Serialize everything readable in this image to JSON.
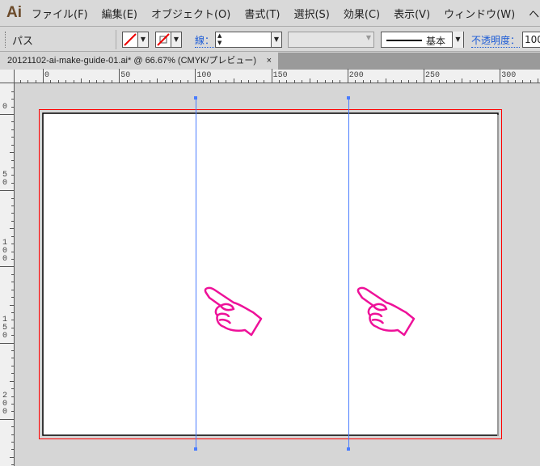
{
  "app": {
    "logo": "Ai"
  },
  "menu": [
    "ファイル(F)",
    "編集(E)",
    "オブジェクト(O)",
    "書式(T)",
    "選択(S)",
    "効果(C)",
    "表示(V)",
    "ウィンドウ(W)",
    "ヘルプ"
  ],
  "control": {
    "selection_label": "パス",
    "stroke_label": "線：",
    "style_label": "基本",
    "opacity_label": "不透明度：",
    "opacity_value": "100"
  },
  "document_tab": {
    "title": "20121102-ai-make-guide-01.ai* @ 66.67% (CMYK/プレビュー)",
    "close": "×"
  },
  "ruler": {
    "h_labels": [
      "0",
      "50",
      "100",
      "150",
      "200",
      "250",
      "300"
    ],
    "v_labels": [
      "0",
      "50",
      "100",
      "150",
      "200"
    ]
  },
  "colors": {
    "guide": "#4a7cff",
    "bleed": "#ff0000",
    "hand": "#ee1199"
  },
  "icons": [
    "pointing-hand-icon"
  ]
}
